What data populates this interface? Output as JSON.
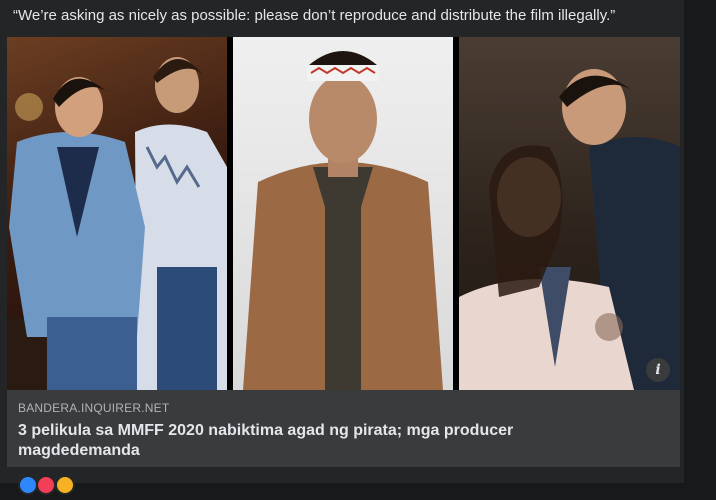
{
  "post": {
    "text": "“We’re asking as nicely as possible: please don’t reproduce and distribute the film illegally.”"
  },
  "media": {
    "info_icon": "i",
    "panels": [
      "movie-poster-left",
      "movie-poster-center",
      "movie-poster-right"
    ]
  },
  "link_preview": {
    "domain": "BANDERA.INQUIRER.NET",
    "headline": "3 pelikula sa MMFF 2020 nabiktima agad ng pirata; mga producer magdedemanda"
  },
  "colors": {
    "background": "#18191a",
    "card": "#242526",
    "link_card": "#3a3b3c",
    "text_primary": "#e4e6eb",
    "text_secondary": "#b0b3b8"
  }
}
